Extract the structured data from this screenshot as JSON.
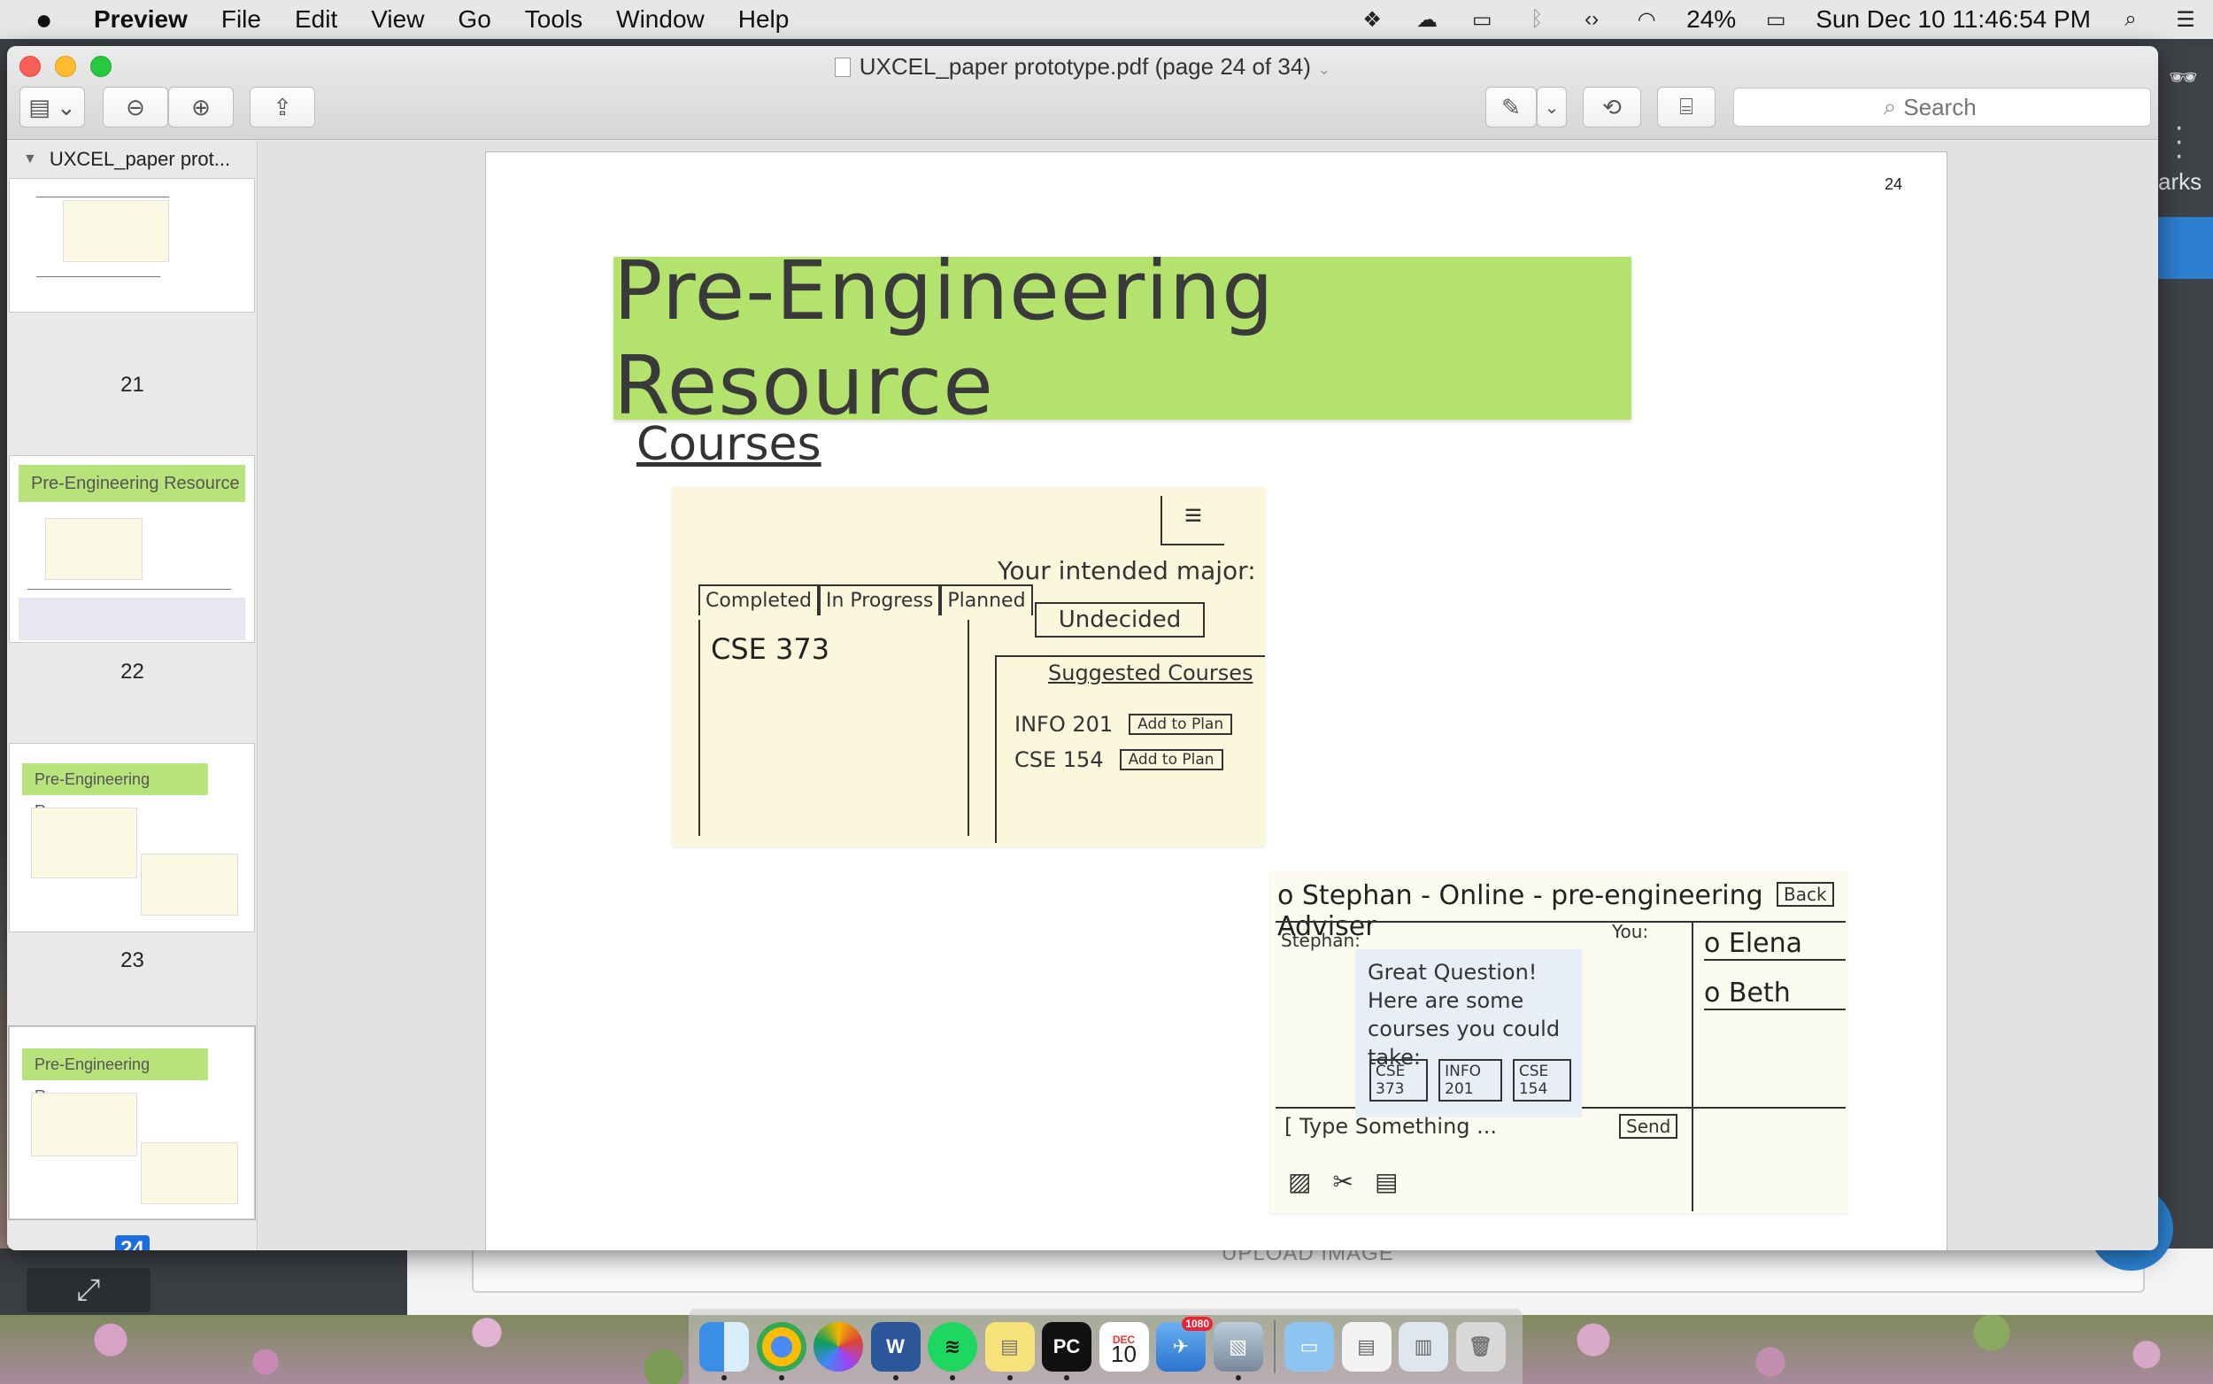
{
  "menubar": {
    "app_name": "Preview",
    "items": [
      "File",
      "Edit",
      "View",
      "Go",
      "Tools",
      "Window",
      "Help"
    ],
    "battery": "24%",
    "datetime": "Sun Dec 10  11:46:54 PM"
  },
  "window": {
    "title": "UXCEL_paper prototype.pdf (page 24 of 34)",
    "search_placeholder": "Search"
  },
  "sidebar": {
    "header": "UXCEL_paper prot...",
    "thumbnails": [
      {
        "page": "21",
        "banner": ""
      },
      {
        "page": "22",
        "banner": "Pre-Engineering Resource"
      },
      {
        "page": "23",
        "banner": "Pre-Engineering Resource"
      },
      {
        "page": "24",
        "banner": "Pre-Engineering Resource"
      }
    ]
  },
  "page": {
    "number": "24",
    "banner": "Pre-Engineering Resource",
    "courses_label": "Courses",
    "tabs": [
      "Completed",
      "In Progress",
      "Planned"
    ],
    "course_item": "CSE 373",
    "major_label": "Your intended major:",
    "major_value": "Undecided",
    "suggested_title": "Suggested Courses",
    "suggested": [
      {
        "course": "INFO 201",
        "action": "Add to Plan"
      },
      {
        "course": "CSE 154",
        "action": "Add to Plan"
      }
    ],
    "chat": {
      "header": "o Stephan - Online - pre-engineering Adviser",
      "back": "Back",
      "stephan_label": "Stephan:",
      "you_label": "You:",
      "message": "Great Question! Here are some courses you could take:",
      "chips": [
        "CSE 373",
        "INFO 201",
        "CSE 154"
      ],
      "contacts": [
        "o Elena",
        "o Beth"
      ],
      "input_placeholder": "[ Type Something ...",
      "send": "Send"
    }
  },
  "background_window": {
    "upload_label": "UPLOAD IMAGE",
    "right_text": "arks"
  },
  "dock": {
    "apps": [
      "finder",
      "chrome",
      "photos",
      "word",
      "spotify",
      "stickies",
      "pycharm",
      "calendar",
      "mail",
      "preview",
      "folder",
      "docs",
      "files",
      "trash"
    ],
    "calendar_day": "10",
    "calendar_month": "DEC",
    "mail_badge": "1080"
  }
}
